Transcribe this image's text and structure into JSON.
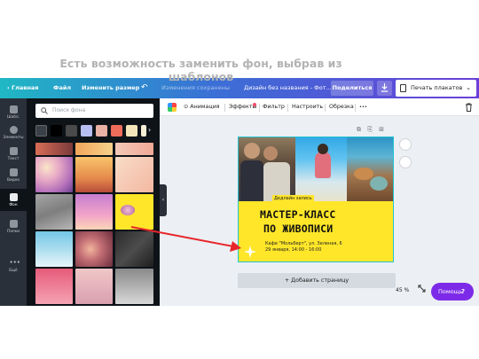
{
  "caption": {
    "line1": "Есть возможность заменить фон, выбрав из",
    "line2": "шаблонов"
  },
  "topbar": {
    "home": "Главная",
    "file": "Файл",
    "resize": "Изменить размер",
    "undo_icon": "↶",
    "saved": "Изменения сохранены",
    "doc_name": "Дизайн без названия - Фот...",
    "share": "Поделиться",
    "print": "Печать плакатов",
    "print_chevron": "⌄"
  },
  "rail": {
    "items": [
      "Шабл.",
      "Элементы",
      "Текст",
      "Видео",
      "Фон",
      "Папки",
      "Ещё"
    ],
    "active": "Фон"
  },
  "panel": {
    "search_placeholder": "Поиск фона",
    "colors": [
      "#000000",
      "#4a4a4a",
      "#b7bff2",
      "#e9b2a5",
      "#ef6c5b",
      "#f3e5b9",
      "#f7f0d6",
      "#ffffff"
    ],
    "chevron": "›",
    "collapse": "‹"
  },
  "toolbar": {
    "animation": "Анимация",
    "effects": "Эффекты",
    "filter": "Фильтр",
    "adjust": "Настроить",
    "crop": "Обрезка",
    "more": "•••"
  },
  "design": {
    "deadline": "Дедлайн запись",
    "title_line1": "МАСТЕР-КЛАСС",
    "title_line2": "ПО ЖИВОПИСИ",
    "info_line1": "Кафе \"Мольберт\", ул. Зеленая, 6",
    "info_line2": "29 января, 14:00 - 16:00"
  },
  "canvas": {
    "add_page": "+ Добавить страницу",
    "zoom": "45 %",
    "help": "Помощь",
    "help_icon": "?"
  },
  "colors": {
    "accent_purple": "#7d2ae8",
    "arrow_red": "#e8262b",
    "poster_yellow": "#ffe629",
    "rail_dark": "#293039",
    "panel_dark": "#0e1318"
  }
}
